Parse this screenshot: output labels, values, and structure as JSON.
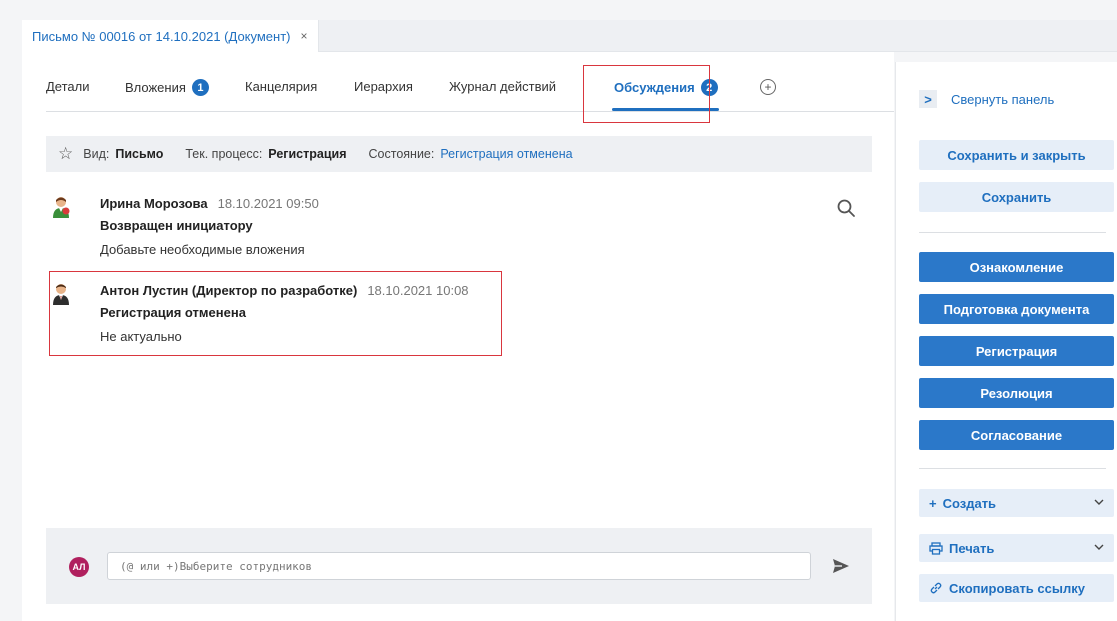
{
  "window": {
    "doc_tab_title": "Письмо № 00016 от 14.10.2021 (Документ)",
    "close_symbol": "×"
  },
  "tabs": [
    {
      "label": "Детали"
    },
    {
      "label": "Вложения",
      "badge": "1"
    },
    {
      "label": "Канцелярия"
    },
    {
      "label": "Иерархия"
    },
    {
      "label": "Журнал действий"
    },
    {
      "label": "Обсуждения",
      "badge": "2",
      "active": true
    }
  ],
  "infobar": {
    "kind_label": "Вид:",
    "kind_value": "Письмо",
    "process_label": "Тек. процесс:",
    "process_value": "Регистрация",
    "state_label": "Состояние:",
    "state_value": "Регистрация отменена"
  },
  "messages": [
    {
      "author": "Ирина Морозова",
      "time": "18.10.2021 09:50",
      "status": "Возвращен инициатору",
      "text": "Добавьте необходимые вложения"
    },
    {
      "author": "Антон Лустин (Директор по разработке)",
      "time": "18.10.2021 10:08",
      "status": "Регистрация отменена",
      "text": "Не актуально"
    }
  ],
  "composer": {
    "avatar_initials": "АЛ",
    "placeholder": "(@ или +)Выберите сотрудников"
  },
  "right_panel": {
    "collapse_label": "Свернуть панель",
    "save_close_label": "Сохранить и закрыть",
    "save_label": "Сохранить",
    "actions": [
      "Ознакомление",
      "Подготовка документа",
      "Регистрация",
      "Резолюция",
      "Согласование"
    ],
    "create_label": "Создать",
    "print_label": "Печать",
    "copy_link_label": "Скопировать ссылку"
  },
  "colors": {
    "accent": "#1f6fbf",
    "primary_button": "#2b78c9",
    "highlight": "#d9363e",
    "avatar_me": "#b0205e"
  }
}
